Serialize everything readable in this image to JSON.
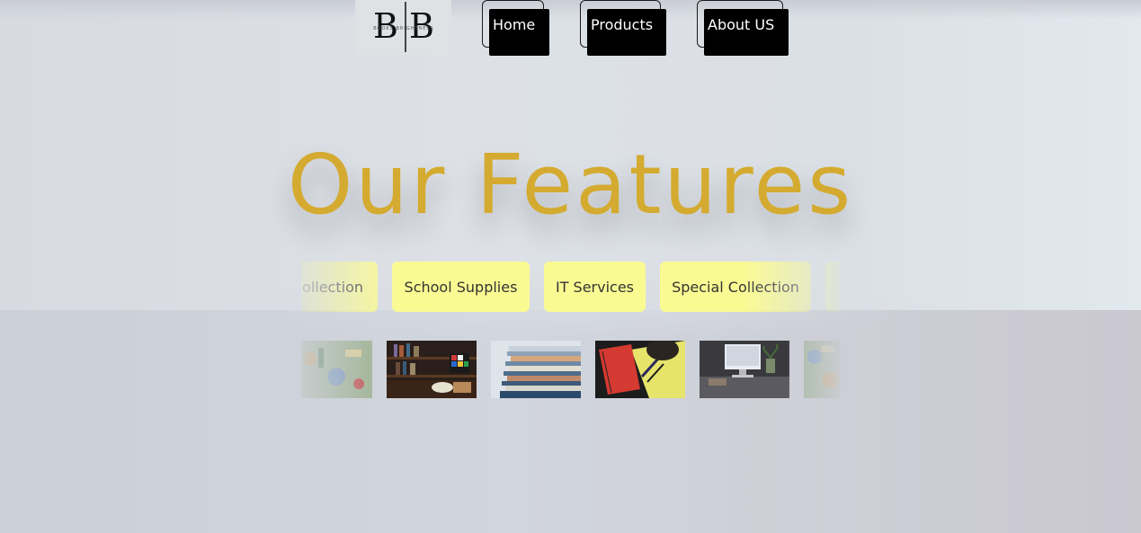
{
  "logo": {
    "letters": "B|B",
    "tagline": "BOOKS BRIGHTNESS"
  },
  "nav": {
    "items": [
      {
        "label": "Home"
      },
      {
        "label": "Products"
      },
      {
        "label": "About US"
      }
    ]
  },
  "main": {
    "title": "Our Features",
    "features": [
      {
        "label": "ollection"
      },
      {
        "label": "School Supplies"
      },
      {
        "label": "IT Services"
      },
      {
        "label": "Special Collection"
      },
      {
        "label": ""
      }
    ],
    "images": [
      {
        "name": "school-supplies-photo"
      },
      {
        "name": "bookshelf-photo"
      },
      {
        "name": "book-stack-photo"
      },
      {
        "name": "notebook-pens-photo"
      },
      {
        "name": "computer-desk-photo"
      },
      {
        "name": "school-supplies-photo"
      }
    ]
  },
  "colors": {
    "accent": "#d4ab30",
    "chip": "#fafa93",
    "nav_fill": "#000000"
  }
}
